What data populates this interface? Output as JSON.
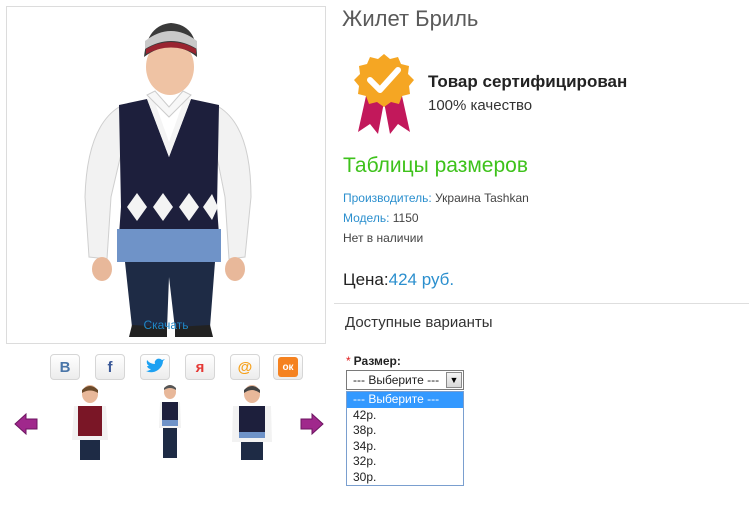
{
  "product": {
    "title": "Жилет Бриль",
    "download_label": "Скачать"
  },
  "social": [
    {
      "name": "vk-icon",
      "glyph": "B",
      "color": "#4a76a8"
    },
    {
      "name": "facebook-icon",
      "glyph": "f",
      "color": "#3b5998"
    },
    {
      "name": "twitter-icon",
      "glyph": "t",
      "color": "#1da1f2"
    },
    {
      "name": "moimir-icon",
      "glyph": "я",
      "color": "#e53935"
    },
    {
      "name": "mailru-icon",
      "glyph": "@",
      "color": "#f6a11c"
    },
    {
      "name": "odnoklassniki-icon",
      "glyph": "ок",
      "color": "#f58220"
    }
  ],
  "certificate": {
    "title": "Товар сертифицирован",
    "subtitle": "100% качество"
  },
  "size_tables_link": "Таблицы размеров",
  "info": {
    "manufacturer_label": "Производитель:",
    "manufacturer_value": " Украина Tashkan",
    "model_label": "Модель:",
    "model_value": " 1150",
    "availability": "Нет в наличии"
  },
  "price": {
    "label": "Цена:",
    "value": "424 руб."
  },
  "options": {
    "heading": "Доступные варианты",
    "size_label": "Размер:",
    "required_mark": "*",
    "selected": "--- Выберите ---",
    "items": [
      "--- Выберите ---",
      "42р.",
      "38р.",
      "34р.",
      "32р.",
      "30р."
    ]
  },
  "colors": {
    "accent_blue": "#2b8fce",
    "link_green": "#3ec21b",
    "thumb_arrow": "#a0288c"
  }
}
